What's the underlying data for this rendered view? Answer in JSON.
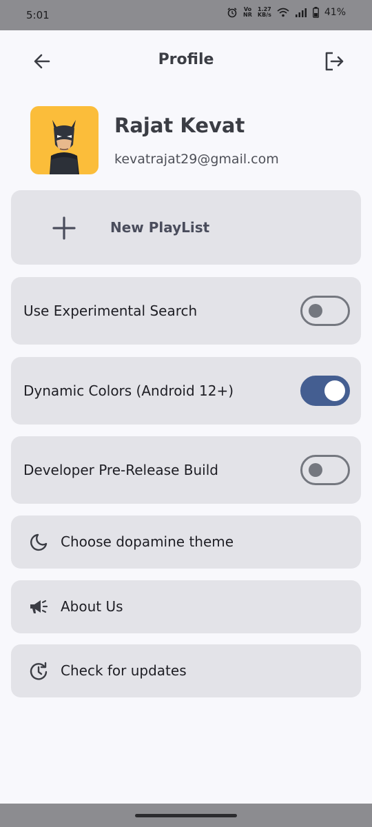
{
  "status_bar": {
    "time": "5:01",
    "net_top": "Vo",
    "net_bottom": "NR",
    "speed_top": "1.27",
    "speed_bottom": "KB/s",
    "battery": "41%"
  },
  "header": {
    "title": "Profile",
    "back_icon": "arrow-left-icon",
    "logout_icon": "logout-icon"
  },
  "profile": {
    "name": "Rajat Kevat",
    "email": "kevatrajat29@gmail.com",
    "avatar_icon": "batman-avatar"
  },
  "new_playlist": {
    "label": "New PlayList",
    "icon": "plus-icon"
  },
  "toggles": [
    {
      "label": "Use Experimental Search",
      "on": false
    },
    {
      "label": "Dynamic Colors (Android 12+)",
      "on": true
    },
    {
      "label": "Developer Pre-Release Build",
      "on": false
    }
  ],
  "links": [
    {
      "label": "Choose dopamine theme",
      "icon": "moon-icon"
    },
    {
      "label": "About Us",
      "icon": "megaphone-icon"
    },
    {
      "label": "Check for updates",
      "icon": "update-clock-icon"
    }
  ],
  "colors": {
    "accent": "#445e91",
    "card_bg": "#e3e3e8",
    "avatar_bg": "#fbbd3a",
    "page_bg": "#f8f8fc"
  }
}
